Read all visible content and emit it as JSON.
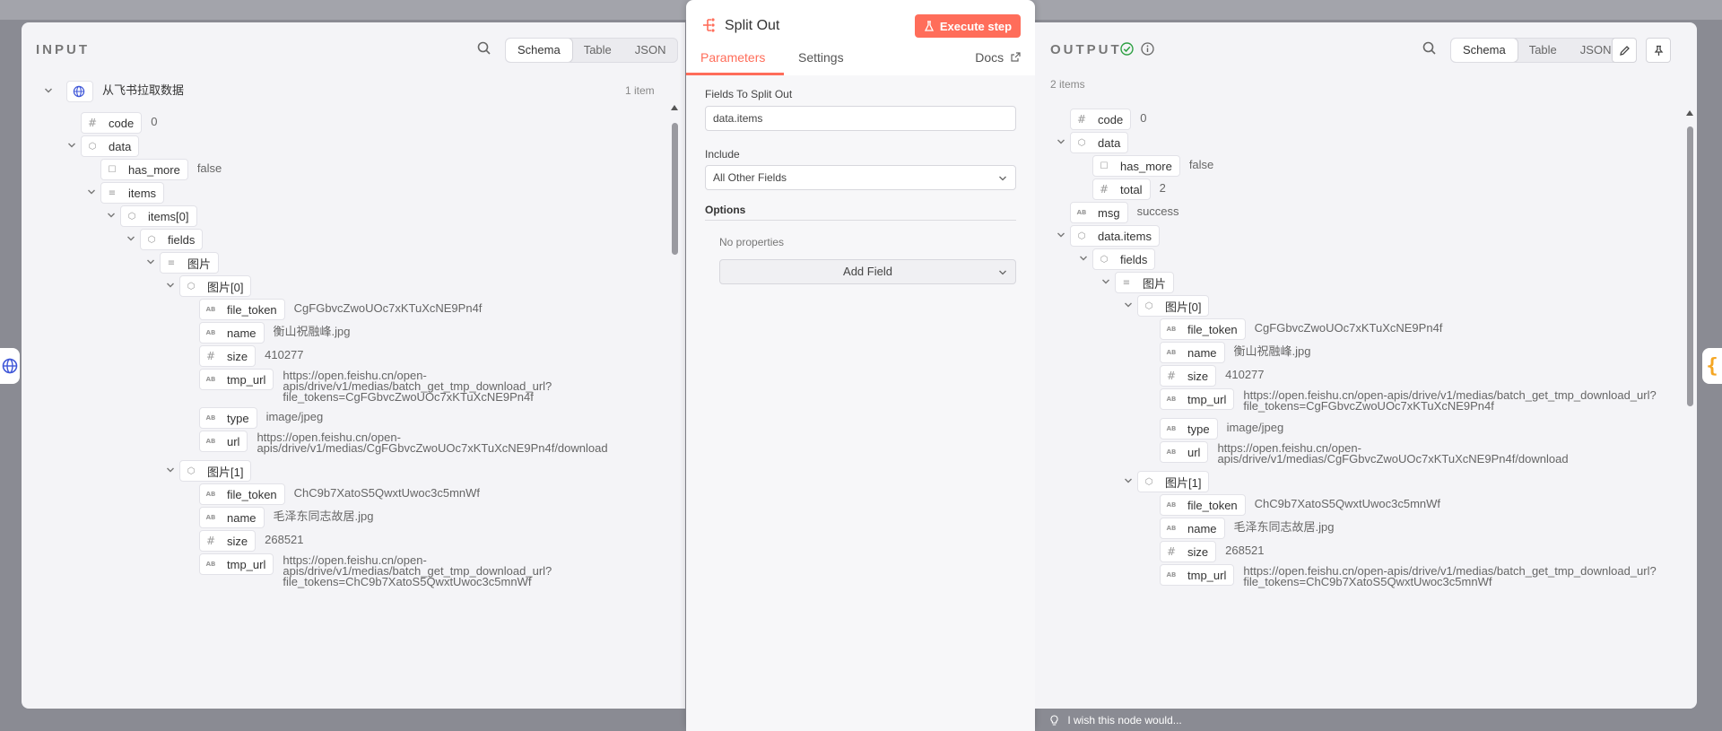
{
  "input": {
    "title": "INPUT",
    "views": [
      "Schema",
      "Table",
      "JSON"
    ],
    "active_view": "Schema",
    "root_label": "从飞书拉取数据",
    "item_count": "1 item",
    "rows": [
      {
        "key": "code",
        "type": "number",
        "value": "0",
        "depth": 1
      },
      {
        "key": "data",
        "type": "object",
        "value": "",
        "depth": 1,
        "collapsible": true
      },
      {
        "key": "has_more",
        "type": "boolean",
        "value": "false",
        "depth": 2
      },
      {
        "key": "items",
        "type": "array",
        "value": "",
        "depth": 2,
        "collapsible": true
      },
      {
        "key": "items[0]",
        "type": "object",
        "value": "",
        "depth": 3,
        "collapsible": true
      },
      {
        "key": "fields",
        "type": "object",
        "value": "",
        "depth": 4,
        "collapsible": true
      },
      {
        "key": "图片",
        "type": "array",
        "value": "",
        "depth": 5,
        "collapsible": true
      },
      {
        "key": "图片[0]",
        "type": "object",
        "value": "",
        "depth": 6,
        "collapsible": true
      },
      {
        "key": "file_token",
        "type": "string",
        "value": "CgFGbvcZwoUOc7xKTuXcNE9Pn4f",
        "depth": 7
      },
      {
        "key": "name",
        "type": "string",
        "value": "衡山祝融峰.jpg",
        "depth": 7
      },
      {
        "key": "size",
        "type": "number",
        "value": "410277",
        "depth": 7
      },
      {
        "key": "tmp_url",
        "type": "string",
        "value": "https://open.feishu.cn/open-\napis/drive/v1/medias/batch_get_tmp_download_url?\nfile_tokens=CgFGbvcZwoUOc7xKTuXcNE9Pn4f",
        "depth": 7,
        "lines": 3
      },
      {
        "key": "type",
        "type": "string",
        "value": "image/jpeg",
        "depth": 7
      },
      {
        "key": "url",
        "type": "string",
        "value": "https://open.feishu.cn/open-\napis/drive/v1/medias/CgFGbvcZwoUOc7xKTuXcNE9Pn4f/download",
        "depth": 7,
        "lines": 2
      },
      {
        "key": "图片[1]",
        "type": "object",
        "value": "",
        "depth": 6,
        "collapsible": true
      },
      {
        "key": "file_token",
        "type": "string",
        "value": "ChC9b7XatoS5QwxtUwoc3c5mnWf",
        "depth": 7
      },
      {
        "key": "name",
        "type": "string",
        "value": "毛泽东同志故居.jpg",
        "depth": 7
      },
      {
        "key": "size",
        "type": "number",
        "value": "268521",
        "depth": 7
      },
      {
        "key": "tmp_url",
        "type": "string",
        "value": "https://open.feishu.cn/open-\napis/drive/v1/medias/batch_get_tmp_download_url?\nfile_tokens=ChC9b7XatoS5QwxtUwoc3c5mnWf",
        "depth": 7,
        "lines": 3
      }
    ]
  },
  "node": {
    "title": "Split Out",
    "execute_label": "Execute step",
    "tabs": [
      "Parameters",
      "Settings"
    ],
    "active_tab": "Parameters",
    "docs_label": "Docs",
    "fields_label": "Fields To Split Out",
    "fields_value": "data.items",
    "include_label": "Include",
    "include_value": "All Other Fields",
    "options_label": "Options",
    "no_properties": "No properties",
    "add_field_label": "Add Field"
  },
  "output": {
    "title": "OUTPUT",
    "views": [
      "Schema",
      "Table",
      "JSON"
    ],
    "active_view": "Schema",
    "item_count": "2 items",
    "rows": [
      {
        "key": "code",
        "type": "number",
        "value": "0",
        "depth": 0
      },
      {
        "key": "data",
        "type": "object",
        "value": "",
        "depth": 0,
        "collapsible": true
      },
      {
        "key": "has_more",
        "type": "boolean",
        "value": "false",
        "depth": 1
      },
      {
        "key": "total",
        "type": "number",
        "value": "2",
        "depth": 1
      },
      {
        "key": "msg",
        "type": "string",
        "value": "success",
        "depth": 0
      },
      {
        "key": "data.items",
        "type": "object",
        "value": "",
        "depth": 0,
        "collapsible": true
      },
      {
        "key": "fields",
        "type": "object",
        "value": "",
        "depth": 1,
        "collapsible": true
      },
      {
        "key": "图片",
        "type": "array",
        "value": "",
        "depth": 2,
        "collapsible": true
      },
      {
        "key": "图片[0]",
        "type": "object",
        "value": "",
        "depth": 3,
        "collapsible": true
      },
      {
        "key": "file_token",
        "type": "string",
        "value": "CgFGbvcZwoUOc7xKTuXcNE9Pn4f",
        "depth": 4
      },
      {
        "key": "name",
        "type": "string",
        "value": "衡山祝融峰.jpg",
        "depth": 4
      },
      {
        "key": "size",
        "type": "number",
        "value": "410277",
        "depth": 4
      },
      {
        "key": "tmp_url",
        "type": "string",
        "value": "https://open.feishu.cn/open-apis/drive/v1/medias/batch_get_tmp_download_url?\nfile_tokens=CgFGbvcZwoUOc7xKTuXcNE9Pn4f",
        "depth": 4,
        "lines": 2
      },
      {
        "key": "type",
        "type": "string",
        "value": "image/jpeg",
        "depth": 4
      },
      {
        "key": "url",
        "type": "string",
        "value": "https://open.feishu.cn/open-\napis/drive/v1/medias/CgFGbvcZwoUOc7xKTuXcNE9Pn4f/download",
        "depth": 4,
        "lines": 2
      },
      {
        "key": "图片[1]",
        "type": "object",
        "value": "",
        "depth": 3,
        "collapsible": true
      },
      {
        "key": "file_token",
        "type": "string",
        "value": "ChC9b7XatoS5QwxtUwoc3c5mnWf",
        "depth": 4
      },
      {
        "key": "name",
        "type": "string",
        "value": "毛泽东同志故居.jpg",
        "depth": 4
      },
      {
        "key": "size",
        "type": "number",
        "value": "268521",
        "depth": 4
      },
      {
        "key": "tmp_url",
        "type": "string",
        "value": "https://open.feishu.cn/open-apis/drive/v1/medias/batch_get_tmp_download_url?\nfile_tokens=ChC9b7XatoS5QwxtUwoc3c5mnWf",
        "depth": 4,
        "lines": 2
      }
    ]
  },
  "feedback_text": "I wish this node would...",
  "colors": {
    "accent": "#ff6d5a",
    "success": "#2ea043",
    "panel": "#f4f4f7"
  }
}
